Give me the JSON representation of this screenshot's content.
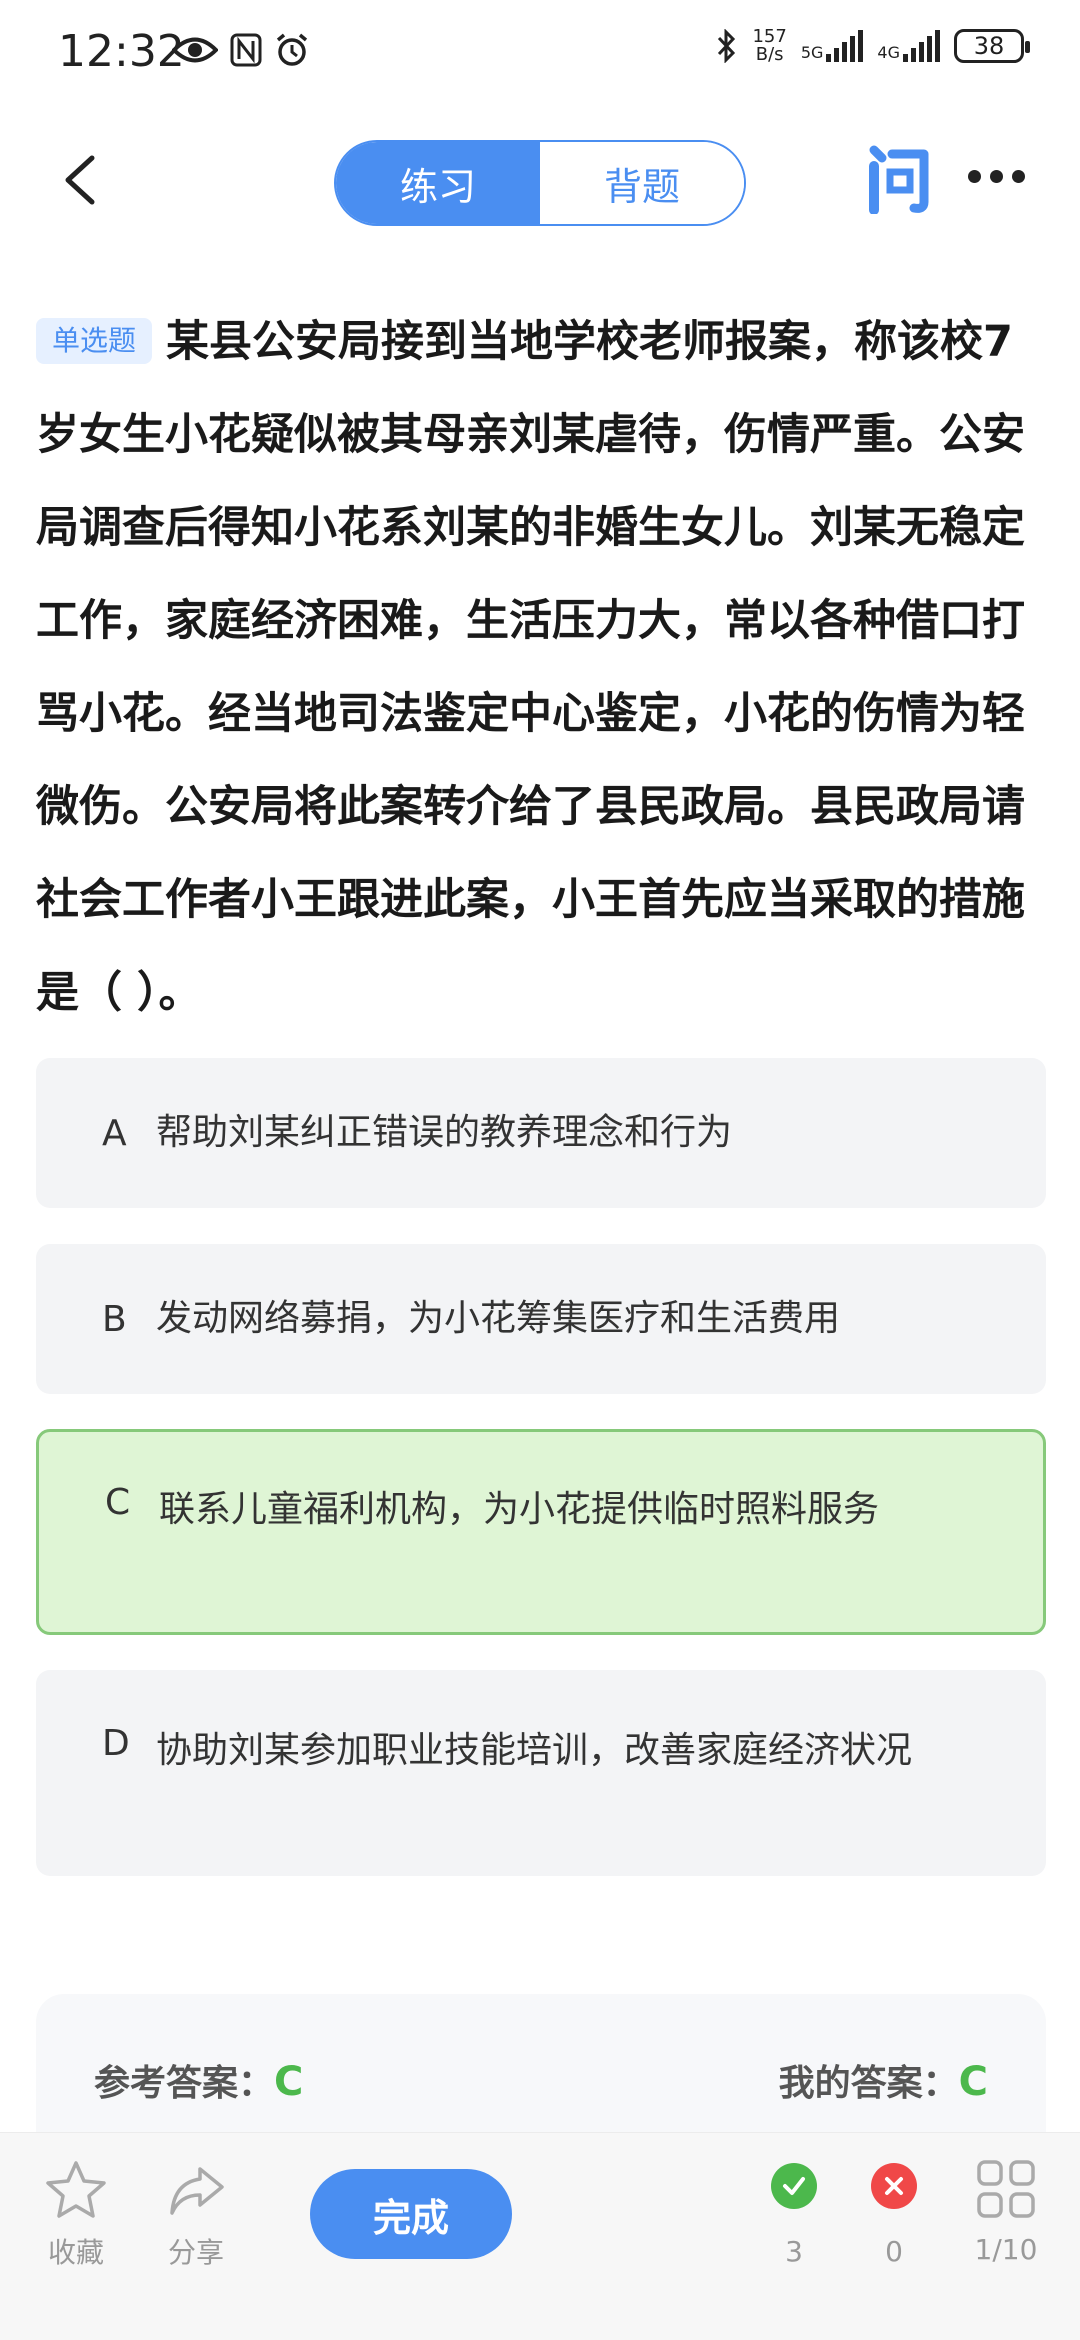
{
  "status": {
    "time": "12:32",
    "speed_top": "157",
    "speed_bottom": "B/s",
    "net1": "5G",
    "net2": "4G",
    "battery": "38"
  },
  "nav": {
    "tab_practice": "练习",
    "tab_recite": "背题",
    "ask_icon": "问"
  },
  "question": {
    "type_tag": "单选题",
    "text": "某县公安局接到当地学校老师报案，称该校7岁女生小花疑似被其母亲刘某虐待，伤情严重。公安局调查后得知小花系刘某的非婚生女儿。刘某无稳定工作，家庭经济困难，生活压力大，常以各种借口打骂小花。经当地司法鉴定中心鉴定，小花的伤情为轻微伤。公安局将此案转介给了县民政局。县民政局请社会工作者小王跟进此案，小王首先应当采取的措施是（ ）。"
  },
  "options": [
    {
      "letter": "A",
      "text": "帮助刘某纠正错误的教养理念和行为"
    },
    {
      "letter": "B",
      "text": "发动网络募捐，为小花筹集医疗和生活费用"
    },
    {
      "letter": "C",
      "text": "联系儿童福利机构，为小花提供临时照料服务"
    },
    {
      "letter": "D",
      "text": "协助刘某参加职业技能培训，改善家庭经济状况"
    }
  ],
  "answer": {
    "ref_label": "参考答案：",
    "ref_value": "C",
    "my_label": "我的答案：",
    "my_value": "C"
  },
  "bottom": {
    "favorite": "收藏",
    "share": "分享",
    "finish": "完成",
    "correct_count": "3",
    "wrong_count": "0",
    "progress": "1/10"
  },
  "colors": {
    "accent": "#4a8ef1",
    "correct_bg": "#dff5d5",
    "correct_border": "#86c97a",
    "answer_green": "#4cb84c",
    "wrong_red": "#f04848"
  }
}
